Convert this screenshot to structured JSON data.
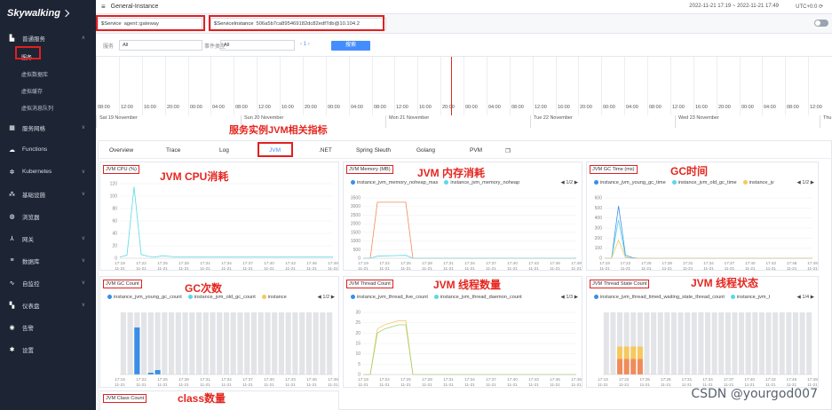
{
  "sidebar": {
    "logo": "Skywalking",
    "items": [
      {
        "icon": "bar-chart-icon",
        "label": "普通服务",
        "chev": "∧"
      },
      {
        "sub": true,
        "label": "服务",
        "active": true
      },
      {
        "sub": true,
        "label": "虚拟数据库"
      },
      {
        "sub": true,
        "label": "虚拟缓存"
      },
      {
        "sub": true,
        "label": "虚拟消息队列"
      },
      {
        "icon": "network-icon",
        "label": "服务网格",
        "chev": "∨"
      },
      {
        "icon": "cloud-icon",
        "label": "Functions",
        "chev": ""
      },
      {
        "icon": "helm-icon",
        "label": "Kubernetes",
        "chev": "∨"
      },
      {
        "icon": "infra-icon",
        "label": "基础设施",
        "chev": "∨"
      },
      {
        "icon": "globe-icon",
        "label": "浏览器",
        "chev": ""
      },
      {
        "icon": "gateway-icon",
        "label": "网关",
        "chev": "∨"
      },
      {
        "icon": "database-icon",
        "label": "数据库",
        "chev": "∨"
      },
      {
        "icon": "self-monitor-icon",
        "label": "自监控",
        "chev": "∨"
      },
      {
        "icon": "dashboard-icon",
        "label": "仪表盘",
        "chev": "∨"
      },
      {
        "icon": "alarm-icon",
        "label": "告警",
        "chev": ""
      },
      {
        "icon": "settings-icon",
        "label": "设置",
        "chev": ""
      }
    ]
  },
  "topbar": {
    "title": "General-Instance",
    "time": "2022-11-21 17:19 ~ 2022-11-21 17:49",
    "utc": "UTC+0:0"
  },
  "selectors": {
    "service_label": "$Service",
    "service_value": "agent::gateway",
    "instance_label": "$ServiceInstance",
    "instance_value": "506a5b7ca895469182dc82edf7db@10.104.2"
  },
  "filters": {
    "service_label": "服务",
    "service_value": "All",
    "type_label": "事件类型",
    "type_value": "All",
    "page": "1",
    "search": "搜索"
  },
  "timeline": {
    "times": [
      "08:00",
      "12:00",
      "16:00",
      "20:00",
      "00:00",
      "04:00",
      "08:00",
      "12:00",
      "16:00",
      "20:00",
      "00:00",
      "04:00",
      "08:00",
      "12:00",
      "16:00",
      "20:00",
      "00:00",
      "04:00",
      "08:00",
      "12:00",
      "16:00",
      "20:00",
      "00:00",
      "04:00",
      "08:00",
      "12:00",
      "16:00",
      "20:00",
      "00:00",
      "04:00",
      "08:00",
      "12:00"
    ],
    "days": [
      "Sat 19 November",
      "Sun 20 November",
      "Mon 21 November",
      "Tue 22 November",
      "Wed 23 November",
      "Thu 24 November"
    ]
  },
  "annotations": {
    "main": "服务实例JVM相关指标",
    "cpu": "JVM CPU消耗",
    "mem": "JVM 内存消耗",
    "gctime": "GC时间",
    "gccount": "GC次数",
    "thread": "JVM 线程数量",
    "threadstate": "JVM 线程状态",
    "classcount": "class数量"
  },
  "tabs": [
    "Overview",
    "Trace",
    "Log",
    "JVM",
    ".NET",
    "Spring Sleuth",
    "Golang",
    "PVM"
  ],
  "active_tab": "JVM",
  "xticks": [
    "17:19",
    "17:22",
    "17:25",
    "17:28",
    "17:31",
    "17:34",
    "17:37",
    "17:40",
    "17:43",
    "17:46",
    "17:49"
  ],
  "xdate": "11-21",
  "cards": {
    "cpu": {
      "title": "JVM CPU (%)"
    },
    "memory": {
      "title": "JVM Memory (MB)",
      "legend": [
        "instance_jvm_memory_noheap_max",
        "instance_jvm_memory_noheap"
      ],
      "page": "1/2"
    },
    "gctime": {
      "title": "JVM GC Time (ms)",
      "legend": [
        "instance_jvm_young_gc_time",
        "instance_jvm_old_gc_time",
        "instance_jv"
      ],
      "page": "1/2"
    },
    "gccount": {
      "title": "JVM GC Count",
      "legend": [
        "instance_jvm_young_gc_count",
        "instance_jvm_old_gc_count",
        "instance"
      ],
      "page": "1/2"
    },
    "thread": {
      "title": "JVM Thread Count",
      "legend": [
        "instance_jvm_thread_live_count",
        "instance_jvm_thread_daemon_count"
      ],
      "page": "1/3"
    },
    "threadstate": {
      "title": "JVM Thread State Count",
      "legend": [
        "instance_jvm_thread_timed_waiting_state_thread_count",
        "instance_jvm_t"
      ],
      "page": "1/4"
    },
    "classcount": {
      "title": "JVM Class Count"
    }
  },
  "colors": {
    "blue": "#3a8ee6",
    "cyan": "#5ad8e6",
    "yellow": "#f6c85f",
    "orange": "#f08b5a",
    "green": "#9bd36f",
    "red": "#e5261f"
  },
  "watermark": "CSDN @yourgod007",
  "chart_data": [
    {
      "type": "line",
      "title": "JVM CPU (%)",
      "x": [
        "17:19",
        "17:20",
        "17:21",
        "17:22",
        "17:23",
        "17:24",
        "17:25",
        "17:26",
        "17:27",
        "17:28",
        "17:31",
        "17:34",
        "17:37",
        "17:40",
        "17:43",
        "17:46",
        "17:49"
      ],
      "series": [
        {
          "values": [
            2,
            5,
            115,
            6,
            3,
            2,
            4,
            3,
            2,
            2,
            2,
            2,
            2,
            2,
            2,
            2,
            2
          ]
        }
      ],
      "ylim": [
        0,
        120
      ],
      "yticks": [
        0,
        20,
        40,
        60,
        80,
        100,
        120
      ]
    },
    {
      "type": "line",
      "title": "JVM Memory (MB)",
      "x": [
        "17:19",
        "17:20",
        "17:21",
        "17:22",
        "17:23",
        "17:24",
        "17:25",
        "17:26",
        "17:27",
        "17:28",
        "17:49"
      ],
      "series": [
        {
          "name": "instance_jvm_memory_noheap_max",
          "values": [
            0,
            0,
            3250,
            3250,
            3250,
            3250,
            3250,
            0,
            0,
            0,
            0
          ]
        },
        {
          "name": "instance_jvm_memory_noheap",
          "values": [
            0,
            0,
            120,
            140,
            150,
            160,
            170,
            0,
            0,
            0,
            0
          ]
        }
      ],
      "ylim": [
        0,
        3500
      ],
      "yticks": [
        0,
        500,
        1000,
        1500,
        2000,
        2500,
        3000,
        3500
      ]
    },
    {
      "type": "line",
      "title": "JVM GC Time (ms)",
      "x": [
        "17:19",
        "17:20",
        "17:21",
        "17:22",
        "17:23",
        "17:24",
        "17:25",
        "17:26",
        "17:49"
      ],
      "series": [
        {
          "name": "instance_jvm_young_gc_time",
          "values": [
            0,
            0,
            520,
            30,
            5,
            0,
            0,
            0,
            0
          ]
        },
        {
          "name": "instance_jvm_old_gc_time",
          "values": [
            0,
            0,
            380,
            10,
            0,
            0,
            0,
            0,
            0
          ]
        },
        {
          "name": "instance_jv",
          "values": [
            0,
            0,
            180,
            5,
            0,
            0,
            0,
            0,
            0
          ]
        }
      ],
      "ylim": [
        0,
        600
      ],
      "yticks": [
        0,
        100,
        200,
        300,
        400,
        500,
        600
      ]
    },
    {
      "type": "bar",
      "title": "JVM GC Count",
      "x": [
        "17:19",
        "17:20",
        "17:21",
        "17:22",
        "17:23",
        "17:24",
        "17:25",
        "17:26",
        "17:27",
        "17:28",
        "17:29",
        "17:30",
        "17:31",
        "17:32",
        "17:33",
        "17:34",
        "17:35",
        "17:36",
        "17:37",
        "17:38",
        "17:39",
        "17:40",
        "17:41",
        "17:42",
        "17:43",
        "17:44",
        "17:45",
        "17:46",
        "17:47",
        "17:48",
        "17:49"
      ],
      "series": [
        {
          "name": "instance_jvm_young_gc_count",
          "values": [
            0,
            0,
            53,
            0,
            2,
            5,
            0,
            0,
            0,
            0,
            0,
            0,
            0,
            0,
            0,
            0,
            0,
            0,
            0,
            0,
            0,
            0,
            0,
            0,
            0,
            0,
            0,
            0,
            0,
            0,
            0
          ]
        }
      ],
      "ylim": [
        0,
        70
      ]
    },
    {
      "type": "line",
      "title": "JVM Thread Count",
      "x": [
        "17:19",
        "17:20",
        "17:21",
        "17:22",
        "17:23",
        "17:24",
        "17:25",
        "17:26",
        "17:49"
      ],
      "series": [
        {
          "name": "instance_jvm_thread_live_count",
          "values": [
            0,
            0,
            22,
            24,
            25,
            26,
            26,
            0,
            0
          ]
        },
        {
          "name": "instance_jvm_thread_daemon_count",
          "values": [
            0,
            0,
            20,
            22,
            23,
            24,
            24,
            0,
            0
          ]
        }
      ],
      "ylim": [
        0,
        30
      ],
      "yticks": [
        0,
        5,
        10,
        15,
        20,
        25,
        30
      ]
    },
    {
      "type": "bar",
      "title": "JVM Thread State Count",
      "x": [
        "17:19",
        "17:20",
        "17:21",
        "17:22",
        "17:23",
        "17:24",
        "17:25",
        "17:26",
        "17:27",
        "17:28",
        "17:29",
        "17:30",
        "17:31",
        "17:32",
        "17:33",
        "17:34",
        "17:35",
        "17:36",
        "17:37",
        "17:38",
        "17:39",
        "17:40",
        "17:41",
        "17:42",
        "17:43",
        "17:44",
        "17:45",
        "17:46",
        "17:47",
        "17:48",
        "17:49"
      ],
      "series": [
        {
          "name": "instance_jvm_thread_timed_waiting_state_thread_count",
          "values": [
            0,
            0,
            10,
            10,
            10,
            10,
            0,
            0,
            0,
            0,
            0,
            0,
            0,
            0,
            0,
            0,
            0,
            0,
            0,
            0,
            0,
            0,
            0,
            0,
            0,
            0,
            0,
            0,
            0,
            0,
            0
          ]
        },
        {
          "name": "instance_jvm_t",
          "values": [
            0,
            0,
            8,
            8,
            8,
            8,
            0,
            0,
            0,
            0,
            0,
            0,
            0,
            0,
            0,
            0,
            0,
            0,
            0,
            0,
            0,
            0,
            0,
            0,
            0,
            0,
            0,
            0,
            0,
            0,
            0
          ]
        }
      ],
      "ylim": [
        0,
        40
      ]
    }
  ]
}
